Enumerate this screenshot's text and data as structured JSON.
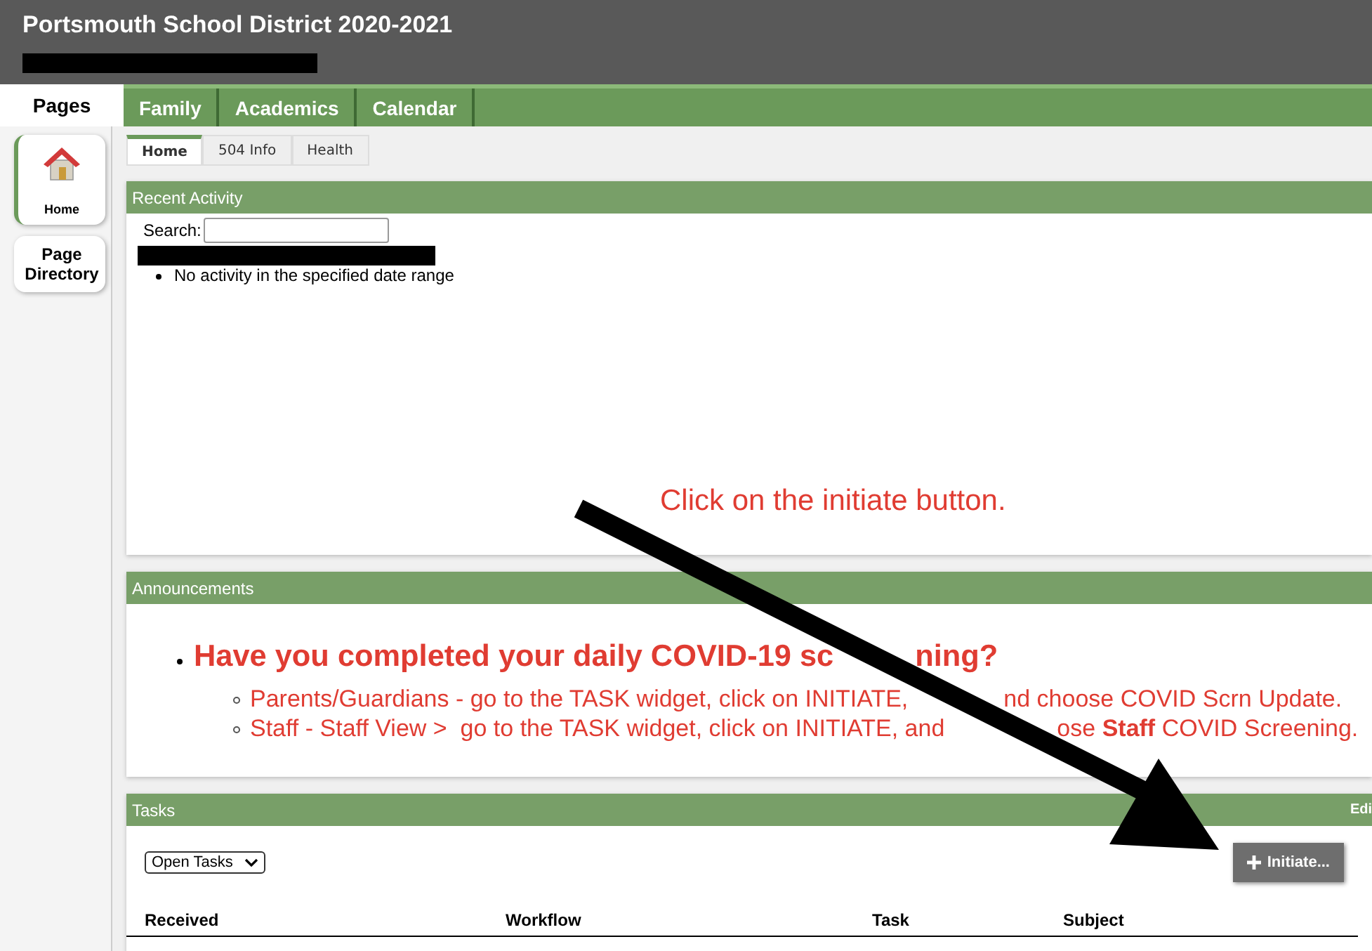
{
  "header": {
    "title": "Portsmouth School District 2020-2021"
  },
  "pages_label": "Pages",
  "top_tabs": [
    {
      "label": "Family"
    },
    {
      "label": "Academics"
    },
    {
      "label": "Calendar"
    }
  ],
  "sidebar": {
    "items": [
      {
        "label": "Home",
        "kind": "icon",
        "selected": true
      },
      {
        "label": "Page Directory",
        "kind": "text",
        "selected": false
      }
    ]
  },
  "sub_tabs": [
    {
      "label": "Home",
      "selected": true
    },
    {
      "label": "504 Info",
      "selected": false
    },
    {
      "label": "Health",
      "selected": false
    }
  ],
  "recent_activity": {
    "title": "Recent Activity",
    "search_label": "Search:",
    "items": [
      "No activity in the specified date range"
    ],
    "annotation": "Click on the initiate button."
  },
  "announcements": {
    "title": "Announcements",
    "headline_parts": [
      "Have you completed your daily COVID-19 sc",
      "ning?"
    ],
    "items": [
      {
        "parts": [
          "Parents/Guardians - go to the TASK widget, click on INITIATE,",
          "nd choose COVID Scrn Update."
        ]
      },
      {
        "parts": [
          "Staff - Staff View >  go to the TASK widget, click on INITIATE, and",
          "ose **Staff** COVID Screening."
        ]
      }
    ]
  },
  "tasks": {
    "title": "Tasks",
    "edit_link": "Edi",
    "filter": "Open Tasks",
    "initiate_button": "Initiate...",
    "columns": [
      "Received",
      "Workflow",
      "Task",
      "Subject"
    ]
  }
}
